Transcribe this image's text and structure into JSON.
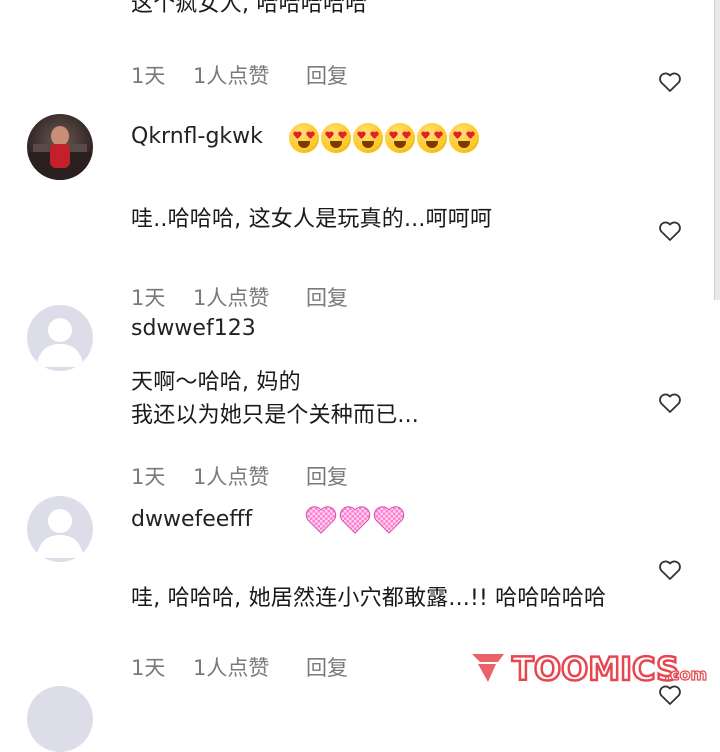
{
  "comments": [
    {
      "text_lines": [
        "这个疯女人, 哈哈哈哈哈"
      ],
      "meta": {
        "time": "1天",
        "likes": "1人点赞",
        "reply": "回复"
      }
    },
    {
      "username": "Qkrnfl-gkwk",
      "emoji_icon": "heart-eyes-emoji",
      "emoji_count": 6,
      "text_lines": [
        "哇..哈哈哈, 这女人是玩真的...呵呵呵"
      ],
      "meta": {
        "time": "1天",
        "likes": "1人点赞",
        "reply": "回复"
      }
    },
    {
      "username": "sdwwef123",
      "text_lines": [
        "天啊～哈哈, 妈的",
        "我还以为她只是个关种而已..."
      ],
      "meta": {
        "time": "1天",
        "likes": "1人点赞",
        "reply": "回复"
      }
    },
    {
      "username": "dwwefeefff",
      "emoji_icon": "pink-heart-emoji",
      "emoji_count": 3,
      "text_lines": [
        "哇, 哈哈哈, 她居然连小穴都敢露...!! 哈哈哈哈哈"
      ],
      "meta": {
        "time": "1天",
        "likes": "1人点赞",
        "reply": "回复"
      }
    }
  ],
  "watermark": {
    "text": "TOOMICS",
    "suffix": ".com",
    "color": "#e8454f"
  },
  "colors": {
    "meta_gray": "#7a7a7a",
    "avatar_default": "#dcdde8",
    "heart_outline": "#333333"
  }
}
